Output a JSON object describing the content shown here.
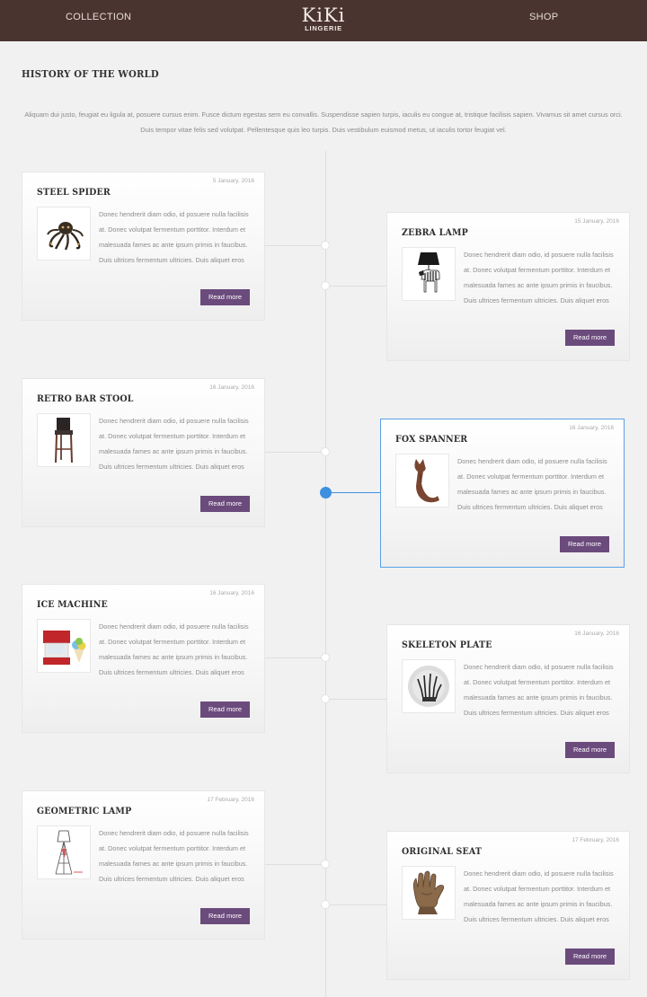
{
  "header": {
    "nav_left": "COLLECTION",
    "nav_right": "SHOP",
    "logo_text": "KiKi",
    "logo_sub": "LINGERIE",
    "bg_color": "#4a3430"
  },
  "page": {
    "title": "HISTORY OF THE WORLD",
    "intro": "Aliquam dui justo, feugiat eu ligula at, posuere cursus enim. Fusce dictum egestas sem eu convallis. Suspendisse sapien turpis, iaculis eu congue at, tristique facilisis sapien. Vivamus sit amet cursus orci. Duis tempor vitae felis sed volutpat. Pellentesque quis leo turpis. Duis vestibulum euismod metus, ut iaculis tortor feugiat vel."
  },
  "accent_color": "#3e8fe0",
  "button_color": "#6b4a7c",
  "items": [
    {
      "title": "STEEL SPIDER",
      "date": "5 January, 2016",
      "text": "Donec hendrerit diam odio, id posuere nulla facilisis at. Donec volutpat fermentum porttitor. Interdum et malesuada fames ac ante ipsum primis in faucibus. Duis ultrices fermentum ultricies. Duis aliquet eros",
      "button": "Read more",
      "icon": "octopus-sculpture-icon"
    },
    {
      "title": "ZEBRA LAMP",
      "date": "15 January, 2016",
      "text": "Donec hendrerit diam odio, id posuere nulla facilisis at. Donec volutpat fermentum porttitor. Interdum et malesuada fames ac ante ipsum primis in faucibus. Duis ultrices fermentum ultricies. Duis aliquet eros",
      "button": "Read more",
      "icon": "zebra-lamp-icon"
    },
    {
      "title": "RETRO BAR STOOL",
      "date": "16 January, 2016",
      "text": "Donec hendrerit diam odio, id posuere nulla facilisis at. Donec volutpat fermentum porttitor. Interdum et malesuada fames ac ante ipsum primis in faucibus. Duis ultrices fermentum ultricies. Duis aliquet eros",
      "button": "Read more",
      "icon": "bar-stool-icon"
    },
    {
      "title": "FOX SPANNER",
      "date": "16 January, 2016",
      "text": "Donec hendrerit diam odio, id posuere nulla facilisis at. Donec volutpat fermentum porttitor. Interdum et malesuada fames ac ante ipsum primis in faucibus. Duis ultrices fermentum ultricies. Duis aliquet eros",
      "button": "Read more",
      "icon": "fox-spanner-icon"
    },
    {
      "title": "ICE MACHINE",
      "date": "16 January, 2016",
      "text": "Donec hendrerit diam odio, id posuere nulla facilisis at. Donec volutpat fermentum porttitor. Interdum et malesuada fames ac ante ipsum primis in faucibus. Duis ultrices fermentum ultricies. Duis aliquet eros",
      "button": "Read more",
      "icon": "ice-machine-icon"
    },
    {
      "title": "SKELETON PLATE",
      "date": "16 January, 2016",
      "text": "Donec hendrerit diam odio, id posuere nulla facilisis at. Donec volutpat fermentum porttitor. Interdum et malesuada fames ac ante ipsum primis in faucibus. Duis ultrices fermentum ultricies. Duis aliquet eros",
      "button": "Read more",
      "icon": "skeleton-plate-icon"
    },
    {
      "title": "GEOMETRIC LAMP",
      "date": "17 February, 2016",
      "text": "Donec hendrerit diam odio, id posuere nulla facilisis at. Donec volutpat fermentum porttitor. Interdum et malesuada fames ac ante ipsum primis in faucibus. Duis ultrices fermentum ultricies. Duis aliquet eros",
      "button": "Read more",
      "icon": "geometric-lamp-icon"
    },
    {
      "title": "ORIGINAL SEAT",
      "date": "17 February, 2016",
      "text": "Donec hendrerit diam odio, id posuere nulla facilisis at. Donec volutpat fermentum porttitor. Interdum et malesuada fames ac ante ipsum primis in faucibus. Duis ultrices fermentum ultricies. Duis aliquet eros",
      "button": "Read more",
      "icon": "hand-chair-icon"
    }
  ]
}
